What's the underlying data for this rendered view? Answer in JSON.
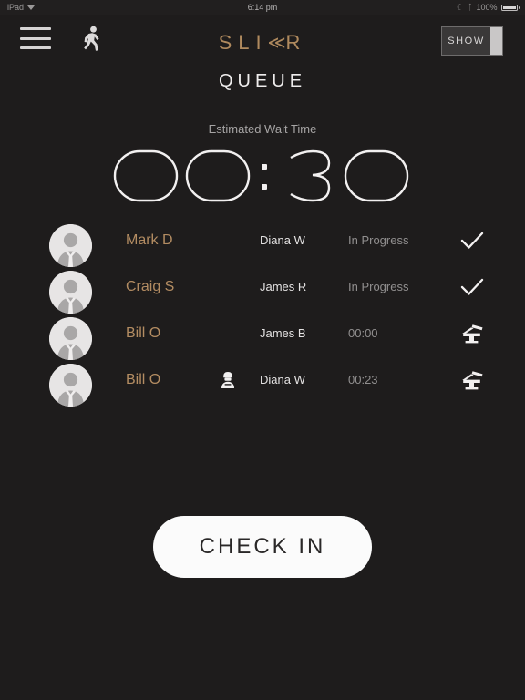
{
  "statusbar": {
    "device": "iPad",
    "wifi_icon": "wifi-icon",
    "time": "6:14 pm",
    "dnd_icon": "moon-icon",
    "bluetooth_icon": "bluetooth-icon",
    "battery_percent": "100%",
    "battery_icon": "battery-full-icon"
  },
  "header": {
    "menu_icon": "hamburger-menu-icon",
    "walk_icon": "walking-person-icon",
    "logo_left": "SLI",
    "logo_chevron": "≪",
    "logo_right": "R",
    "logo_color": "#b08a5e",
    "show_toggle_label": "SHOW"
  },
  "main": {
    "page_title": "QUEUE",
    "wait_label": "Estimated Wait Time",
    "wait_time": "00:30",
    "wait_time_digits": [
      "0",
      "0",
      ":",
      "3",
      "0"
    ]
  },
  "queue": {
    "rows": [
      {
        "avatar_icon": "person-avatar-icon",
        "client": "Mark D",
        "has_stylist_icon": false,
        "stylist_icon": "",
        "stylist": "Diana W",
        "status": "In Progress",
        "action_icon": "checkmark-icon"
      },
      {
        "avatar_icon": "person-avatar-icon",
        "client": "Craig S",
        "has_stylist_icon": false,
        "stylist_icon": "",
        "stylist": "James R",
        "status": "In Progress",
        "action_icon": "checkmark-icon"
      },
      {
        "avatar_icon": "person-avatar-icon",
        "client": "Bill O",
        "has_stylist_icon": false,
        "stylist_icon": "",
        "stylist": "James B",
        "status": "00:00",
        "action_icon": "barber-chair-icon"
      },
      {
        "avatar_icon": "person-avatar-icon",
        "client": "Bill O",
        "has_stylist_icon": true,
        "stylist_icon": "stylist-person-icon",
        "stylist": "Diana W",
        "status": "00:23",
        "action_icon": "barber-chair-icon"
      }
    ]
  },
  "footer": {
    "check_in_label": "CHECK IN"
  },
  "colors": {
    "background": "#1e1c1c",
    "accent_bronze": "#b38c62",
    "text_primary": "#e4e2e2",
    "text_muted": "#918f8f",
    "button_bg": "#fbfbfb"
  }
}
